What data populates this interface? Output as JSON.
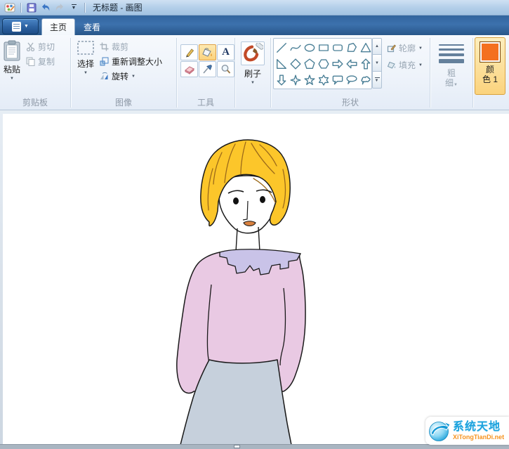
{
  "window": {
    "title": "无标题 - 画图"
  },
  "tabs": {
    "home": "主页",
    "view": "查看"
  },
  "ribbon": {
    "clipboard": {
      "label": "剪贴板",
      "paste": "粘贴",
      "cut": "剪切",
      "copy": "复制"
    },
    "image": {
      "label": "图像",
      "select": "选择",
      "crop": "裁剪",
      "resize": "重新调整大小",
      "rotate": "旋转"
    },
    "tools": {
      "label": "工具",
      "text_tool": "A"
    },
    "brushes": {
      "button": "刷子"
    },
    "shapes": {
      "label": "形状",
      "outline": "轮廓",
      "fill": "填充"
    },
    "size": {
      "line1": "粗",
      "line2": "细"
    },
    "colors": {
      "line1": "颜",
      "line2": "色 1"
    }
  },
  "icons": {
    "caret": "▼",
    "scroll_up": "▲",
    "scroll_down": "▼"
  },
  "watermark": {
    "title": "系统天地",
    "domain": "XiTongTianDi.net"
  },
  "drawing": {
    "subject": "freehand portrait of a woman with short blonde hair, pink sweater with lavender collar and blue-gray skirt",
    "colors": {
      "hair": "#fcc62a",
      "sweater": "#e9c9e3",
      "collar": "#c9c3e8",
      "skirt": "#c6d0dc",
      "mouth": "#d9813f"
    }
  },
  "theme": {
    "selected_highlight": "#fbd27e",
    "color1_swatch": "#f4701f",
    "shape_stroke": "#4a7f96"
  }
}
